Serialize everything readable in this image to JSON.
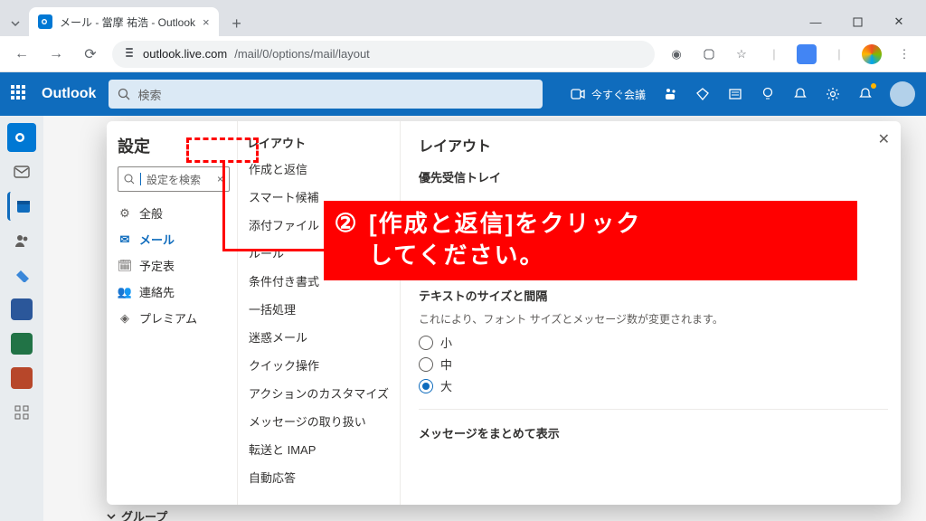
{
  "browser": {
    "tab_title": "メール - 當摩 祐浩 - Outlook",
    "url_host": "outlook.live.com",
    "url_path": "/mail/0/options/mail/layout"
  },
  "owa": {
    "brand": "Outlook",
    "search_placeholder": "検索",
    "meet_now": "今すぐ会議"
  },
  "settings": {
    "title": "設定",
    "search_placeholder": "設定を検索",
    "categories": [
      {
        "icon": "gear",
        "label": "全般"
      },
      {
        "icon": "mail",
        "label": "メール",
        "active": true
      },
      {
        "icon": "calendar",
        "label": "予定表"
      },
      {
        "icon": "people",
        "label": "連絡先"
      },
      {
        "icon": "diamond",
        "label": "プレミアム"
      }
    ]
  },
  "mail_sub": {
    "section": "レイアウト",
    "items": [
      "作成と返信",
      "スマート候補",
      "添付ファイル",
      "ルール",
      "条件付き書式",
      "一括処理",
      "迷惑メール",
      "クイック操作",
      "アクションのカスタマイズ",
      "メッセージの取り扱い",
      "転送と IMAP",
      "自動応答"
    ]
  },
  "layout_panel": {
    "title": "レイアウト",
    "focused_inbox_heading": "優先受信トレイ",
    "text_size_heading": "テキストのサイズと間隔",
    "text_size_help": "これにより、フォント サイズとメッセージ数が変更されます。",
    "text_sizes": {
      "small": "小",
      "medium": "中",
      "large": "大"
    },
    "grouped_heading": "メッセージをまとめて表示"
  },
  "below_modal": "グループ",
  "annotation": {
    "number": "②",
    "text_line1": "[作成と返信]をクリック",
    "text_line2": "してください。"
  }
}
